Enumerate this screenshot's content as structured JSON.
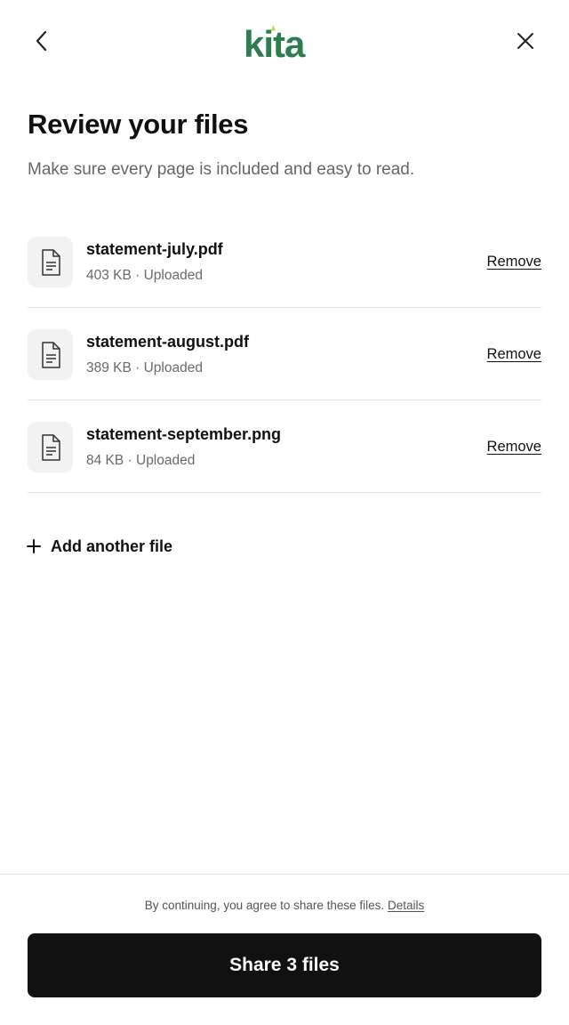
{
  "header": {
    "logo_text": "kita",
    "back_icon": "chevron-left-icon",
    "close_icon": "close-icon",
    "brand_color": "#2e7d4f",
    "accent_color": "#c8d64a"
  },
  "page": {
    "title": "Review your files",
    "subtitle": "Make sure every page is included and easy to read."
  },
  "files": [
    {
      "name": "statement-july.pdf",
      "meta": "403 KB · Uploaded",
      "remove_label": "Remove",
      "icon": "document-icon"
    },
    {
      "name": "statement-august.pdf",
      "meta": "389 KB · Uploaded",
      "remove_label": "Remove",
      "icon": "document-icon"
    },
    {
      "name": "statement-september.png",
      "meta": "84 KB · Uploaded",
      "remove_label": "Remove",
      "icon": "document-icon"
    }
  ],
  "add_file": {
    "label": "Add another file",
    "icon": "plus-icon"
  },
  "footer": {
    "consent_text": "By continuing, you agree to share these files.",
    "details_link": "Details",
    "share_button": "Share 3 files"
  }
}
